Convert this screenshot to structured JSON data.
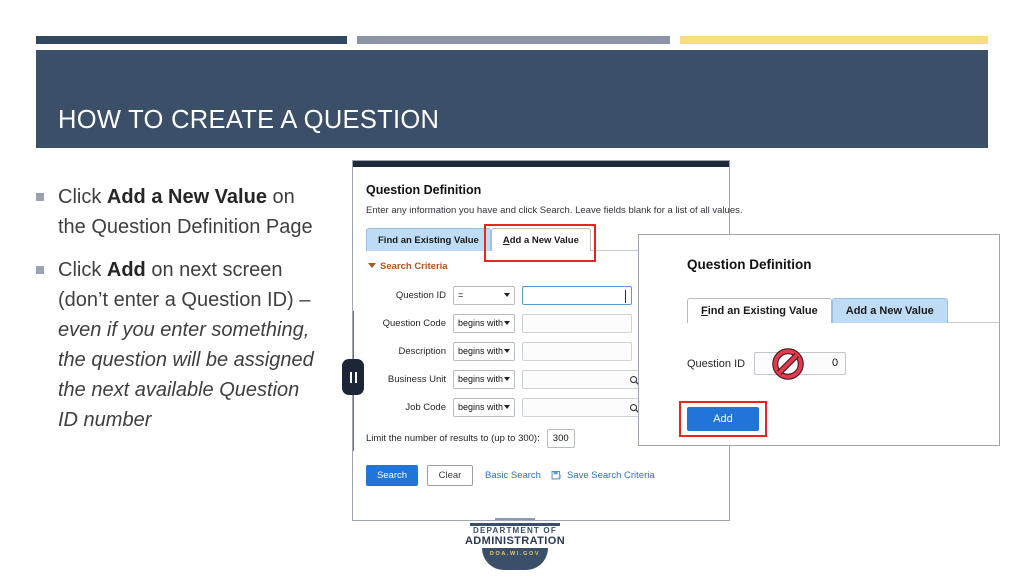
{
  "slide": {
    "title": "HOW TO CREATE A QUESTION",
    "accent_navy": "#33475f",
    "accent_gray": "#8b95a5",
    "accent_yellow": "#f6dd80",
    "banner_color": "#3c4f68"
  },
  "bullets": [
    {
      "segments": [
        {
          "text": "Click ",
          "style": "normal"
        },
        {
          "text": "Add a New Value",
          "style": "bold"
        },
        {
          "text": " on the Question Definition Page",
          "style": "normal"
        }
      ]
    },
    {
      "segments": [
        {
          "text": "Click ",
          "style": "normal"
        },
        {
          "text": "Add",
          "style": "bold"
        },
        {
          "text": " on next screen (don’t enter a Question ID) – ",
          "style": "normal"
        },
        {
          "text": "even if you enter something, the question will be assigned the next available Question ID number",
          "style": "italic"
        }
      ]
    }
  ],
  "panel1": {
    "title": "Question Definition",
    "subtitle": "Enter any information you have and click Search. Leave fields blank for a list of all values.",
    "tabs": [
      {
        "label": "Find an Existing Value",
        "active": true,
        "accesskey": ""
      },
      {
        "label": "Add a New Value",
        "active": false,
        "accesskey": "A",
        "highlighted": true
      }
    ],
    "section_heading": "Search Criteria",
    "fields": [
      {
        "label": "Question ID",
        "operator": "=",
        "value": "",
        "lookup": false,
        "focused": true
      },
      {
        "label": "Question Code",
        "operator": "begins with",
        "value": "",
        "lookup": false,
        "focused": false
      },
      {
        "label": "Description",
        "operator": "begins with",
        "value": "",
        "lookup": false,
        "focused": false
      },
      {
        "label": "Business Unit",
        "operator": "begins with",
        "value": "",
        "lookup": true,
        "focused": false
      },
      {
        "label": "Job Code",
        "operator": "begins with",
        "value": "",
        "lookup": true,
        "focused": false
      }
    ],
    "limit_label": "Limit the number of results to (up to 300):",
    "limit_value": "300",
    "search_button": "Search",
    "clear_button": "Clear",
    "basic_search_link": "Basic Search",
    "save_search_link": "Save Search Criteria",
    "highlight_color": "#e8251f",
    "active_tab_color": "#bfdcf6",
    "button_color": "#2175d9"
  },
  "panel2": {
    "title": "Question Definition",
    "tabs": [
      {
        "label": "Find an Existing Value",
        "active": false,
        "accesskey": "F"
      },
      {
        "label": "Add a New Value",
        "active": true,
        "accesskey": ""
      }
    ],
    "field_label": "Question ID",
    "field_value": "0",
    "field_blocked": true,
    "add_button": "Add",
    "highlight_color": "#e8251f"
  },
  "footer_logo": {
    "line1": "DEPARTMENT OF",
    "line2": "ADMINISTRATION",
    "arc_text": "DOA.WI.GOV"
  }
}
